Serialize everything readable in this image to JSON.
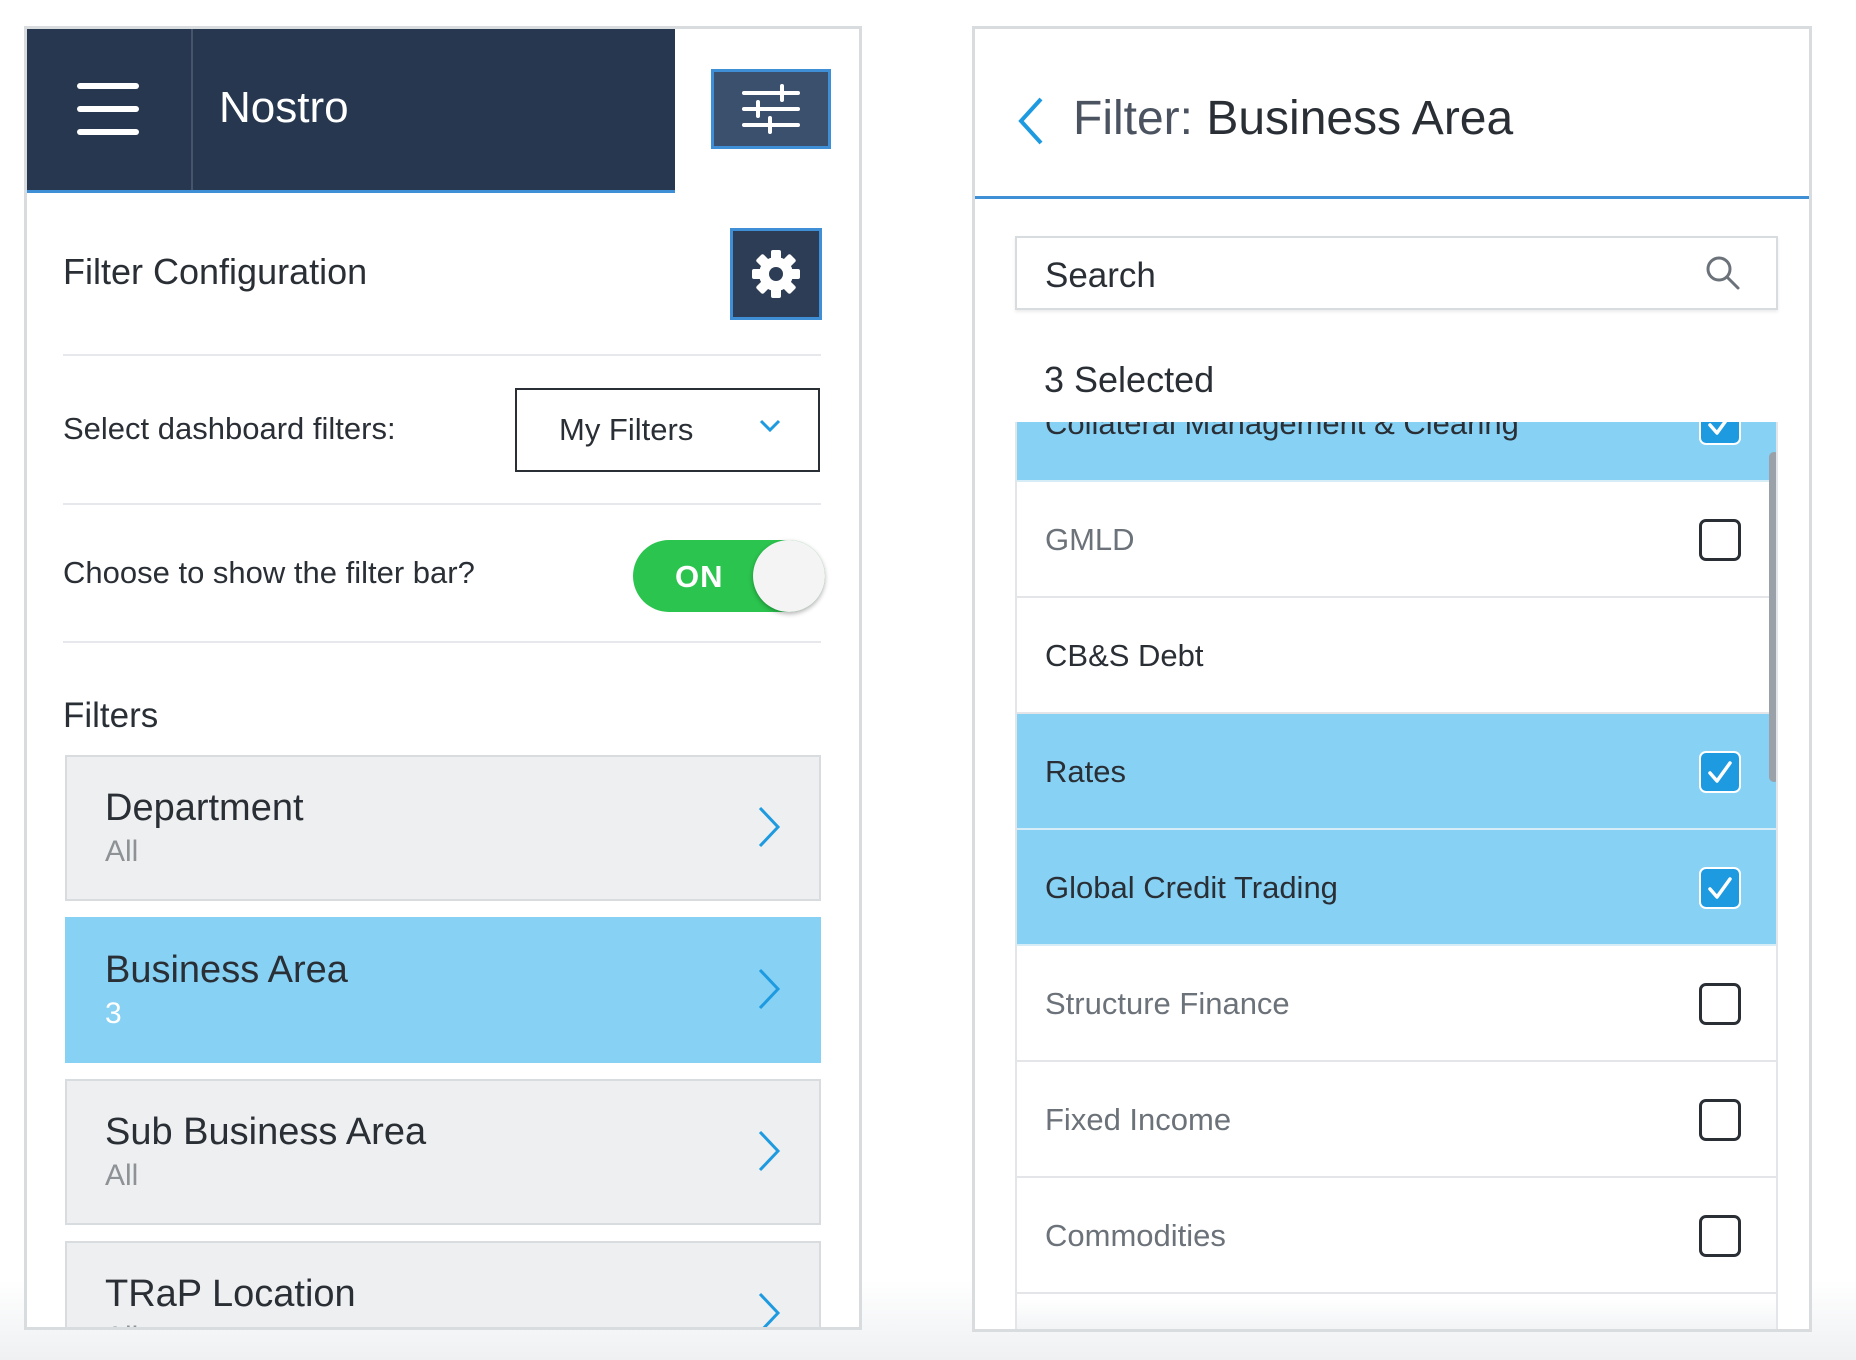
{
  "left_panel": {
    "app_title": "Nostro",
    "section_title": "Filter Configuration",
    "dashboard_filters_label": "Select dashboard filters:",
    "dashboard_filters_value": "My Filters",
    "show_filter_bar_label": "Choose to show the filter bar?",
    "show_filter_bar_toggle": "ON",
    "filters_heading": "Filters",
    "filters": [
      {
        "name": "Department",
        "value": "All",
        "active": false
      },
      {
        "name": "Business Area",
        "value": "3",
        "active": true
      },
      {
        "name": "Sub Business Area",
        "value": "All",
        "active": false
      },
      {
        "name": "TRaP Location",
        "value": "All",
        "active": false
      }
    ]
  },
  "right_panel": {
    "title_prefix": "Filter:",
    "title": "Business Area",
    "search_placeholder": "Search",
    "selected_count": "3 Selected",
    "items": [
      {
        "label": "Collateral Management & Clearing",
        "checked": true
      },
      {
        "label": "GMLD",
        "checked": false
      },
      {
        "label": "CB&S Debt",
        "checked": false
      },
      {
        "label": "Rates",
        "checked": true
      },
      {
        "label": "Global Credit Trading",
        "checked": true
      },
      {
        "label": "Structure Finance",
        "checked": false
      },
      {
        "label": "Fixed Income",
        "checked": false
      },
      {
        "label": "Commodities",
        "checked": false
      }
    ]
  },
  "colors": {
    "nav_bg": "#273750",
    "accent_blue": "#3f8fd6",
    "selected_bg": "#86d1f4",
    "toggle_on": "#2bc44e",
    "checkbox_checked": "#1e9ae0"
  },
  "icons": {
    "menu": "hamburger-menu-icon",
    "filter": "sliders-icon",
    "settings": "gear-icon",
    "dropdown": "chevron-down-icon",
    "row": "chevron-right-icon",
    "back": "chevron-left-icon",
    "search": "search-icon",
    "check": "checkmark-icon"
  }
}
